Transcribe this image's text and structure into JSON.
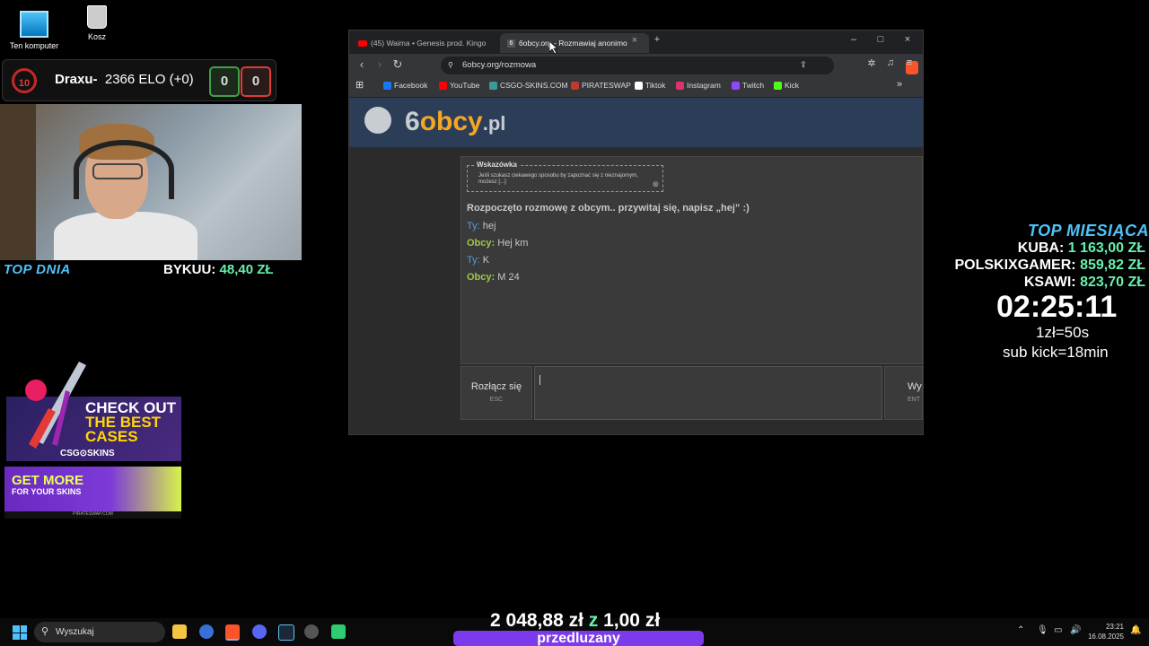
{
  "desktop": {
    "icon_pc": "Ten komputer",
    "icon_bin": "Kosz"
  },
  "elo": {
    "level": "10",
    "name": "Draxu-",
    "elo": "2366 ELO (+0)",
    "wins": "0",
    "losses": "0"
  },
  "overlay_left": {
    "top_dnia": "TOP DNIA",
    "bykuu_name": "BYKUU:",
    "bykuu_value": "48,40 ZŁ"
  },
  "ads": {
    "ad1_title_1": "CHECK OUT",
    "ad1_title_2": "THE BEST",
    "ad1_title_3": "CASES",
    "ad1_brand": "CSG⊙SKINS",
    "ad2_title_1": "GET MORE",
    "ad2_sub": "FOR YOUR SKINS",
    "ad2_footer": "PIRATESWAP.COM"
  },
  "browser": {
    "tab1": "(45) Waima • Genesis prod. Kingo",
    "tab2": "6obcy.org - Rozmawiaj anonimo",
    "tab2_icon": "6",
    "url": "6obcy.org/rozmowa",
    "bookmarks": [
      "Facebook",
      "YouTube",
      "CSGO-SKINS.COM",
      "PIRATESWAP",
      "Tiktok",
      "Instagram",
      "Twitch",
      "Kick"
    ],
    "bookmark_colors": [
      "#1877f2",
      "#ff0000",
      "#3a9a9a",
      "#c0392b",
      "#ffffff",
      "#e1306c",
      "#9146ff",
      "#53fc18"
    ]
  },
  "site": {
    "logo_6": "6",
    "logo_obcy": "obcy",
    "logo_pl": ".pl",
    "hint_title": "Wskazówka",
    "hint_body": "Jeśli szukasz ciekawego sposobu by zapoznać się z nieznajomym, możesz [...]",
    "system_msg": "Rozpoczęto rozmowę z obcym.. przywitaj się, napisz „hej” :)",
    "messages": [
      {
        "who": "Ty:",
        "text": "hej"
      },
      {
        "who": "Obcy:",
        "text": "Hej km"
      },
      {
        "who": "Ty:",
        "text": "K"
      },
      {
        "who": "Obcy:",
        "text": "M 24"
      }
    ],
    "disconnect_label": "Rozłącz się",
    "disconnect_key": "ESC",
    "send_label": "Wy",
    "send_key": "ENT"
  },
  "overlay_right": {
    "title": "TOP MIESIĄCA",
    "ranks": [
      {
        "name": "KUBA:",
        "value": "1 163,00 ZŁ"
      },
      {
        "name": "POLSKIXGAMER:",
        "value": "859,82 ZŁ"
      },
      {
        "name": "KSAWI:",
        "value": "823,70 ZŁ"
      }
    ],
    "timer": "02:25:11",
    "rate": "1zł=50s",
    "sub_kick": "sub kick=18min"
  },
  "bottom": {
    "total_left": "2 048,88 zł",
    "z": "z",
    "total_right": "1,00 zł",
    "label": "przedluzany"
  },
  "taskbar": {
    "search": "Wyszukaj",
    "time": "23:21",
    "date": "16.08.2025"
  }
}
